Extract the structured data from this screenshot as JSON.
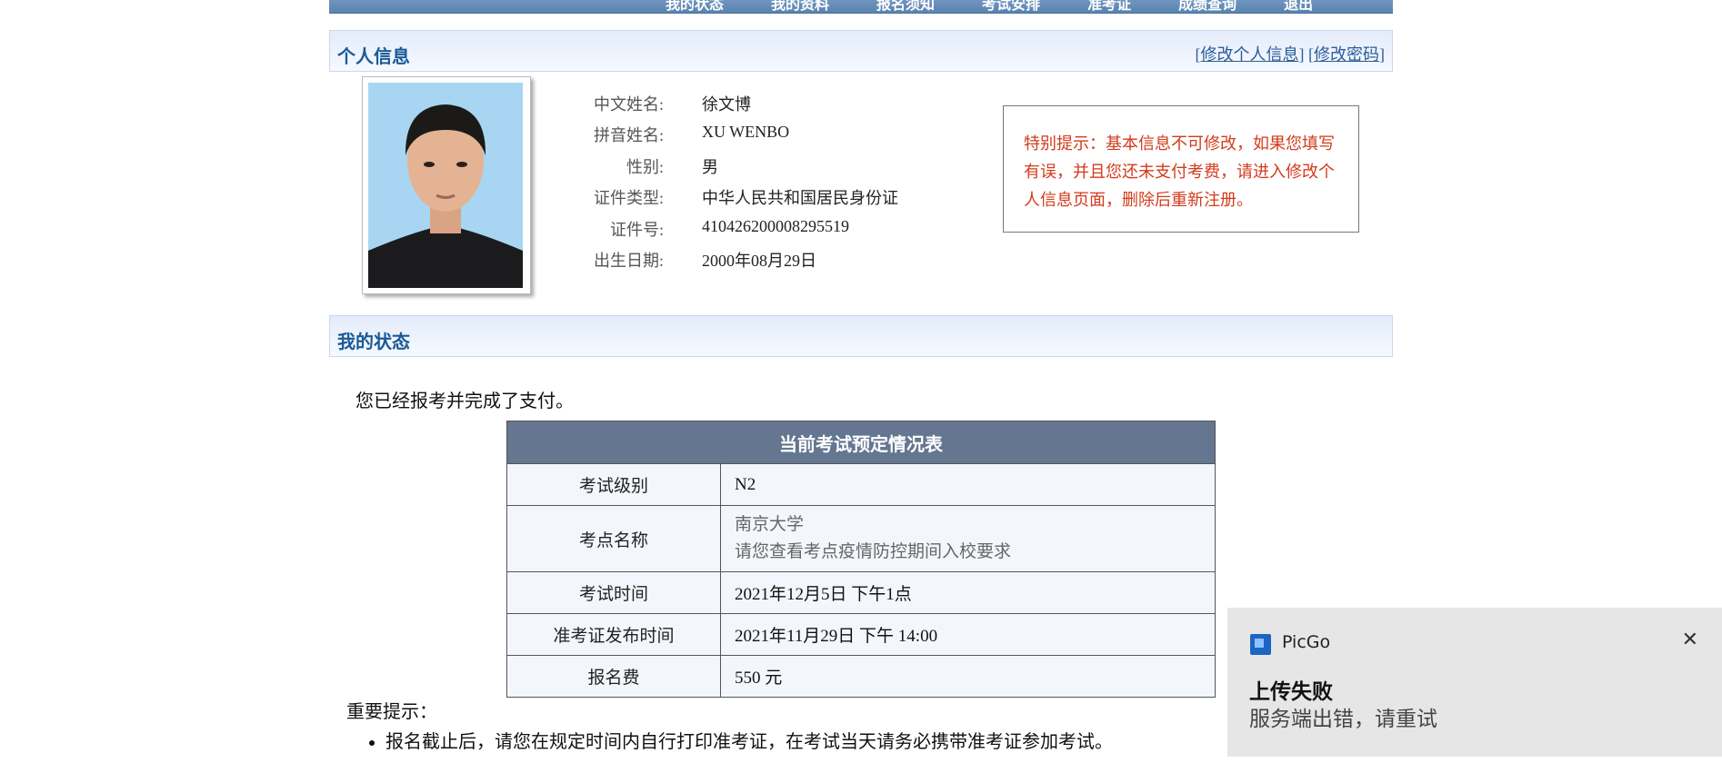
{
  "topnav": {
    "items": [
      "我的状态",
      "我的资料",
      "报名须知",
      "考试安排",
      "准考证",
      "成绩查询",
      "退出"
    ]
  },
  "personal_section": {
    "title": "个人信息",
    "edit_info_link": "修改个人信息",
    "change_password_link": "修改密码"
  },
  "profile": {
    "fields": [
      {
        "label": "中文姓名:",
        "value": "徐文博"
      },
      {
        "label": "拼音姓名:",
        "value": "XU WENBO"
      },
      {
        "label": "性别:",
        "value": "男"
      },
      {
        "label": "证件类型:",
        "value": "中华人民共和国居民身份证"
      },
      {
        "label": "证件号:",
        "value": "410426200008295519"
      },
      {
        "label": "出生日期:",
        "value": "2000年08月29日"
      }
    ]
  },
  "notice": {
    "text": "特别提示：基本信息不可修改，如果您填写有误，并且您还未支付考费，请进入修改个人信息页面，删除后重新注册。"
  },
  "status_section": {
    "title": "我的状态",
    "status_text": "您已经报考并完成了支付。"
  },
  "exam_table": {
    "title": "当前考试预定情况表",
    "rows": [
      {
        "label": "考试级别",
        "value": "N2"
      },
      {
        "label": "考点名称",
        "value_line1": "南京大学",
        "value_line2": "请您查看考点疫情防控期间入校要求"
      },
      {
        "label": "考试时间",
        "value": "2021年12月5日 下午1点"
      },
      {
        "label": "准考证发布时间",
        "value": "2021年11月29日 下午 14:00"
      },
      {
        "label": "报名费",
        "value": "550 元"
      }
    ]
  },
  "important": {
    "title": "重要提示：",
    "tips": [
      "报名截止后，请您在规定时间内自行打印准考证，在考试当天请务必携带准考证参加考试。"
    ]
  },
  "toast": {
    "app_name": "PicGo",
    "title": "上传失败",
    "message": "服务端出错，请重试"
  }
}
